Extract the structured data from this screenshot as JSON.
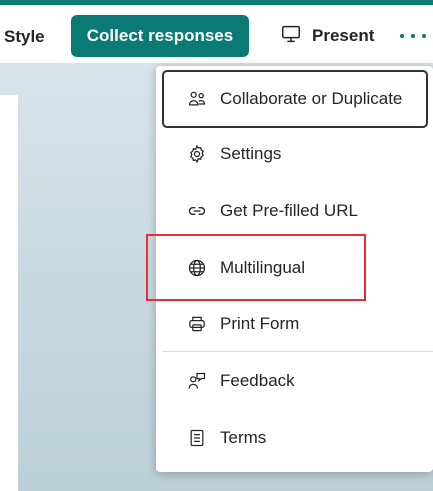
{
  "toolbar": {
    "style_label": "Style",
    "collect_label": "Collect responses",
    "present_label": "Present",
    "present_icon": "monitor-icon",
    "more_icon": "more-horizontal-icon",
    "accent_color": "#0b7a75"
  },
  "menu": {
    "items": [
      {
        "label": "Collaborate or Duplicate",
        "icon": "people-icon"
      },
      {
        "label": "Settings",
        "icon": "gear-icon"
      },
      {
        "label": "Get Pre-filled URL",
        "icon": "link-icon"
      },
      {
        "label": "Multilingual",
        "icon": "globe-icon"
      },
      {
        "label": "Print Form",
        "icon": "printer-icon"
      },
      {
        "label": "Feedback",
        "icon": "person-feedback-icon"
      },
      {
        "label": "Terms",
        "icon": "document-icon"
      }
    ],
    "focused_item": "Collaborate or Duplicate",
    "highlighted_item": "Multilingual",
    "highlight_color": "#e0303a"
  }
}
